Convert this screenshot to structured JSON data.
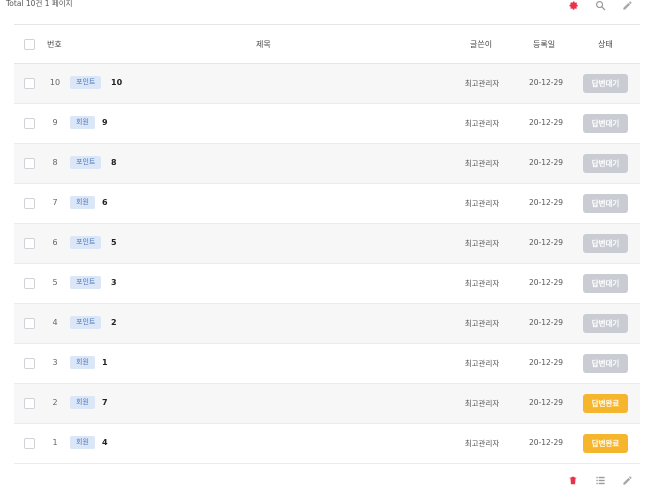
{
  "summary": {
    "total_text": "Total 10건 1 페이지"
  },
  "toolbar": {
    "settings_icon": "gear-icon",
    "search_icon": "search-icon",
    "write_icon": "pencil-icon",
    "accent_color": "#e8334a"
  },
  "columns": {
    "number": "번호",
    "title": "제목",
    "writer": "글쓴이",
    "date": "등록일",
    "status": "상태"
  },
  "rows": [
    {
      "num": "10",
      "category": "포인트",
      "title": "10",
      "writer": "최고관리자",
      "date": "20-12-29",
      "status": "답변대기",
      "status_type": "wait"
    },
    {
      "num": "9",
      "category": "회원",
      "title": "9",
      "writer": "최고관리자",
      "date": "20-12-29",
      "status": "답변대기",
      "status_type": "wait"
    },
    {
      "num": "8",
      "category": "포인트",
      "title": "8",
      "writer": "최고관리자",
      "date": "20-12-29",
      "status": "답변대기",
      "status_type": "wait"
    },
    {
      "num": "7",
      "category": "회원",
      "title": "6",
      "writer": "최고관리자",
      "date": "20-12-29",
      "status": "답변대기",
      "status_type": "wait"
    },
    {
      "num": "6",
      "category": "포인트",
      "title": "5",
      "writer": "최고관리자",
      "date": "20-12-29",
      "status": "답변대기",
      "status_type": "wait"
    },
    {
      "num": "5",
      "category": "포인트",
      "title": "3",
      "writer": "최고관리자",
      "date": "20-12-29",
      "status": "답변대기",
      "status_type": "wait"
    },
    {
      "num": "4",
      "category": "포인트",
      "title": "2",
      "writer": "최고관리자",
      "date": "20-12-29",
      "status": "답변대기",
      "status_type": "wait"
    },
    {
      "num": "3",
      "category": "회원",
      "title": "1",
      "writer": "최고관리자",
      "date": "20-12-29",
      "status": "답변대기",
      "status_type": "wait"
    },
    {
      "num": "2",
      "category": "회원",
      "title": "7",
      "writer": "최고관리자",
      "date": "20-12-29",
      "status": "답변완료",
      "status_type": "done"
    },
    {
      "num": "1",
      "category": "회원",
      "title": "4",
      "writer": "최고관리자",
      "date": "20-12-29",
      "status": "답변완료",
      "status_type": "done"
    }
  ],
  "bottom_toolbar": {
    "delete_icon": "trash-icon",
    "list_icon": "list-icon",
    "write_icon": "pencil-icon"
  }
}
